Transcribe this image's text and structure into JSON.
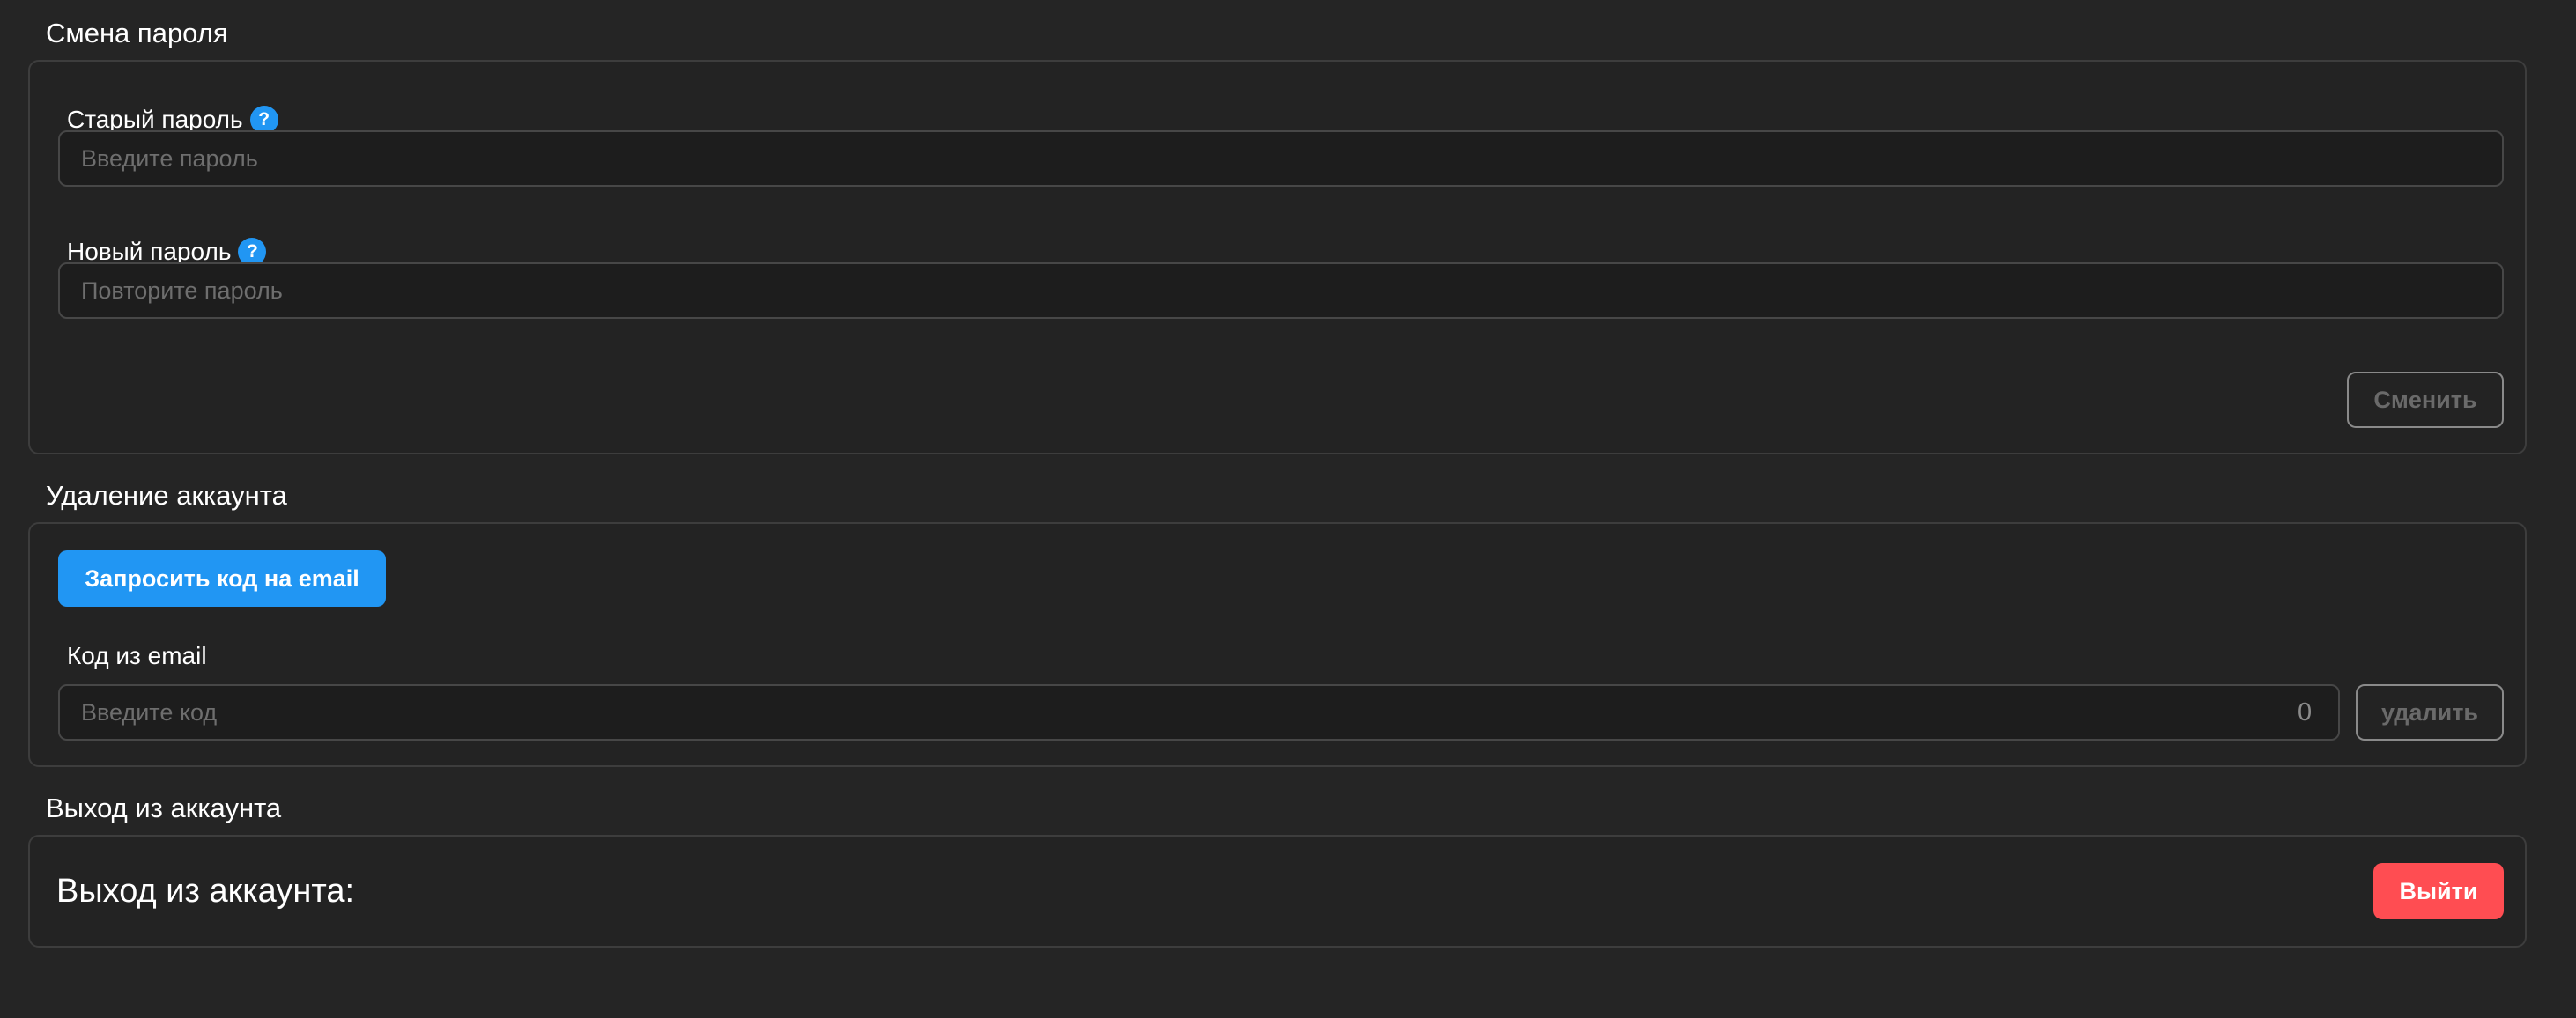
{
  "change_password": {
    "title": "Смена пароля",
    "old_password": {
      "label": "Старый пароль",
      "help_icon": "help-circle-icon",
      "help_glyph": "?",
      "placeholder": "Введите пароль",
      "value": ""
    },
    "new_password": {
      "label": "Новый пароль",
      "help_icon": "help-circle-icon",
      "help_glyph": "?",
      "placeholder": "Повторите пароль",
      "value": ""
    },
    "submit_label": "Сменить"
  },
  "delete_account": {
    "title": "Удаление аккаунта",
    "request_code_label": "Запросить код на email",
    "code_field": {
      "label": "Код из email",
      "placeholder": "Введите код",
      "value": "",
      "char_count": "0"
    },
    "delete_label": "удалить"
  },
  "logout": {
    "title": "Выход из аккаунта",
    "caption": "Выход из аккаунта:",
    "button_label": "Выйти"
  },
  "colors": {
    "background": "#252525",
    "accent": "#2196f3",
    "danger": "#ff4d52",
    "card_border": "#3d3d3d"
  }
}
